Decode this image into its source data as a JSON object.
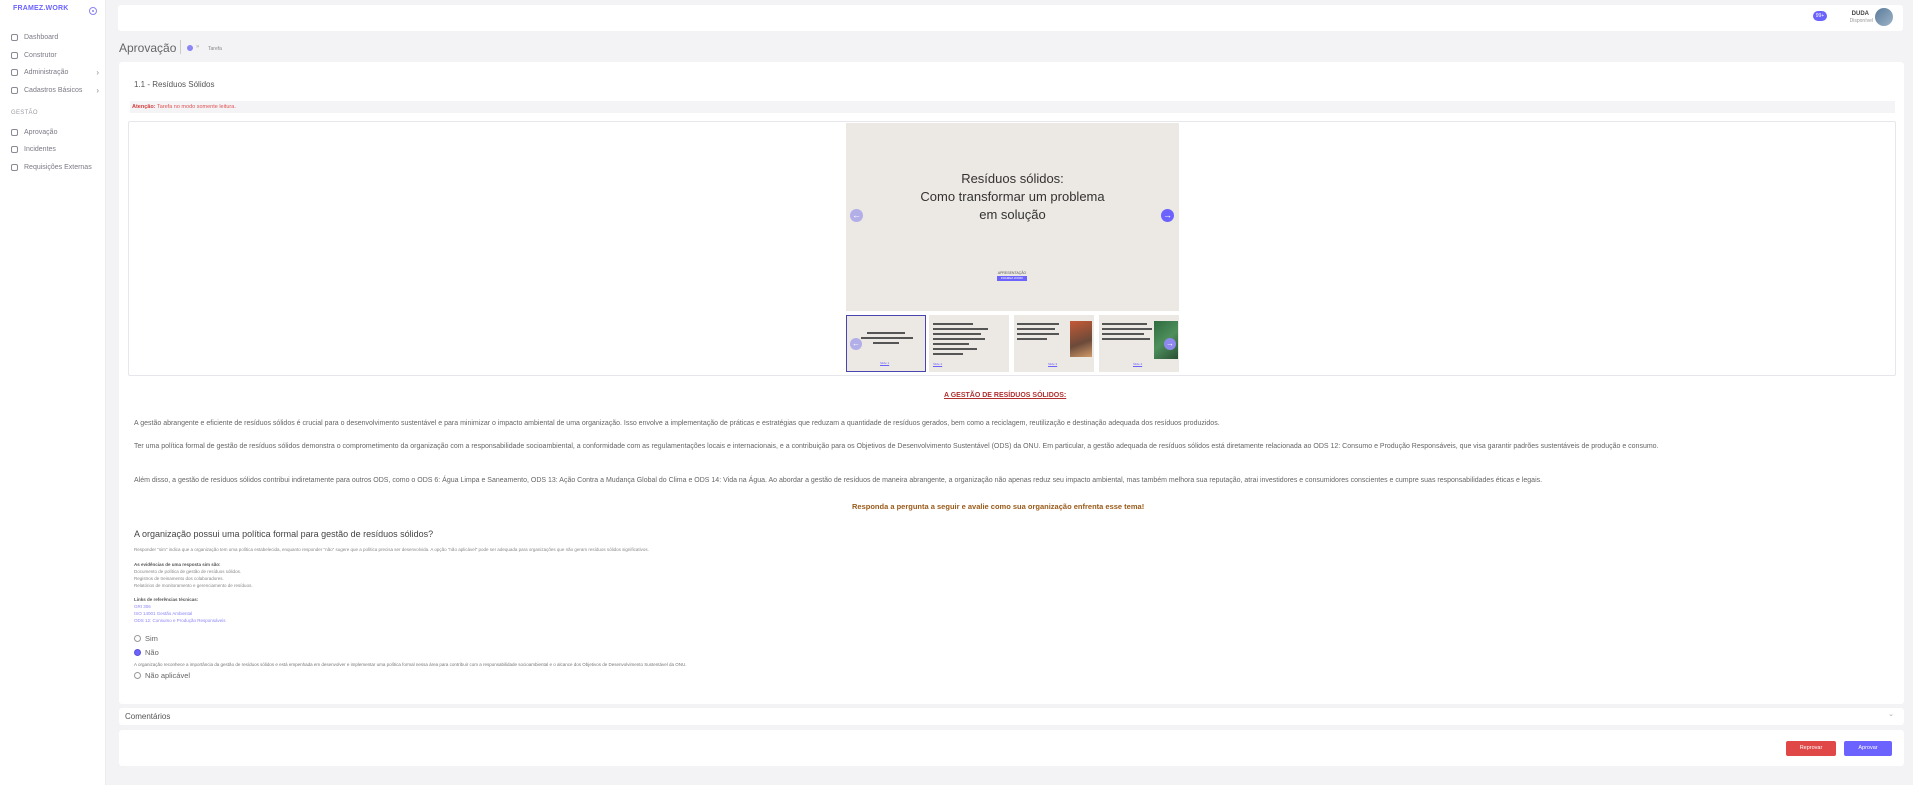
{
  "app": {
    "logo": "FRAMEZ.WORK"
  },
  "sidebar": {
    "items": [
      {
        "label": "Dashboard",
        "icon": "dashboard-icon"
      },
      {
        "label": "Construtor",
        "icon": "builder-icon"
      },
      {
        "label": "Administração",
        "icon": "admin-icon"
      },
      {
        "label": "Cadastros Básicos",
        "icon": "registry-icon"
      }
    ],
    "section_label": "GESTÃO",
    "section_items": [
      {
        "label": "Aprovação",
        "icon": "approval-icon"
      },
      {
        "label": "Incidentes",
        "icon": "incidents-icon"
      },
      {
        "label": "Requisições Externas",
        "icon": "requests-icon"
      }
    ]
  },
  "topbar": {
    "notification_count": "99+",
    "user_name": "DUDA",
    "user_status": "Disponível"
  },
  "page": {
    "title": "Aprovação",
    "breadcrumb": "Tarefa"
  },
  "task": {
    "title": "1.1 - Resíduos Sólidos",
    "alert_label": "Atenção:",
    "alert_text": "Tarefa no modo somente leitura.",
    "slide_title_lines": [
      "Resíduos sólidos:",
      "Como transformar um problema",
      "em solução"
    ],
    "slide_badge_top": "APRESENTAÇÃO",
    "slide_badge_bottom": "FRAMEZ.WORK",
    "thumb_labels": [
      "Slide 1",
      "Slide 2",
      "Slide 3",
      "Slide 4"
    ],
    "heading": "A GESTÃO DE RESÍDUOS SÓLIDOS:",
    "paragraphs": [
      "A gestão abrangente e eficiente de resíduos sólidos é crucial para o desenvolvimento sustentável e para minimizar o impacto ambiental de uma organização. Isso envolve a implementação de práticas e estratégias que reduzam a quantidade de resíduos gerados, bem como a reciclagem, reutilização e destinação adequada dos resíduos produzidos.",
      "Ter uma política formal de gestão de resíduos sólidos demonstra o comprometimento da organização com a responsabilidade socioambiental, a conformidade com as regulamentações locais e internacionais, e a contribuição para os Objetivos de Desenvolvimento Sustentável (ODS) da ONU. Em particular, a gestão adequada de resíduos sólidos está diretamente relacionada ao ODS 12: Consumo e Produção Responsáveis, que visa garantir padrões sustentáveis de produção e consumo.",
      "Além disso, a gestão de resíduos sólidos contribui indiretamente para outros ODS, como o ODS 6: Água Limpa e Saneamento, ODS 13: Ação Contra a Mudança Global do Clima e ODS 14: Vida na Água. Ao abordar a gestão de resíduos de maneira abrangente, a organização não apenas reduz seu impacto ambiental, mas também melhora sua reputação, atrai investidores e consumidores conscientes e cumpre suas responsabilidades éticas e legais."
    ],
    "cta": "Responda a pergunta a seguir e avalie como sua organização enfrenta esse tema!"
  },
  "question": {
    "text": "A organização possui uma política formal para gestão de resíduos sólidos?",
    "help": "Responder \"sim\" indica que a organização tem uma política estabelecida, enquanto responder \"não\" sugere que a política precisa ser desenvolvida. A opção \"não aplicável\" pode ser adequada para organizações que não geram resíduos sólidos significativos.",
    "evidence_heading": "As evidências de uma resposta sim são:",
    "evidence": [
      "Documento de política de gestão de resíduos sólidos.",
      "Registros de treinamento dos colaboradores.",
      "Relatórios de monitoramento e gerenciamento de resíduos."
    ],
    "refs_heading": "Links de referências técnicas:",
    "refs": [
      "GRI 306",
      "ISO 14001 Gestão Ambiental",
      "ODS 12: Consumo e Produção Responsáveis"
    ],
    "options": [
      "Sim",
      "Não",
      "Não aplicável"
    ],
    "selected_index": 1,
    "selected_description": "A organização reconhece a importância da gestão de resíduos sólidos e está empenhada em desenvolver e implementar uma política formal nessa área para contribuir com a responsabilidade socioambiental e o alcance dos Objetivos de Desenvolvimento Sustentável da ONU."
  },
  "comments": {
    "label": "Comentários"
  },
  "actions": {
    "reject": "Reprovar",
    "approve": "Aprovar"
  },
  "colors": {
    "accent": "#6c63ff",
    "danger": "#e04848",
    "alert_text": "#e05252"
  }
}
